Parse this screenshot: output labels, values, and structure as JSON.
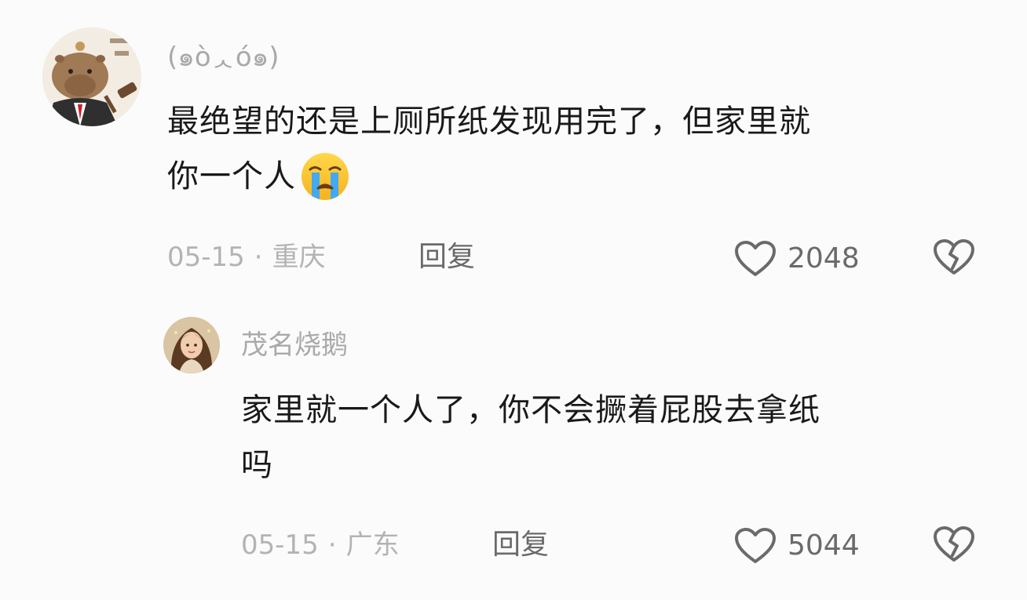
{
  "comments": [
    {
      "username": "(๑òᆺó๑)",
      "avatar_icon": "capybara-judge-avatar",
      "text_line1": "最绝望的还是上厕所纸发现用完了，但家里就",
      "text_line2": "你一个人",
      "emoji_icon": "crying-face-icon",
      "date": "05-15",
      "separator": "·",
      "location": "重庆",
      "reply_label": "回复",
      "like_count": "2048"
    },
    {
      "username": "茂名烧鹅",
      "avatar_icon": "girl-portrait-avatar",
      "text_line1": "家里就一个人了，你不会撅着屁股去拿纸",
      "text_line2": "吗",
      "date": "05-15",
      "separator": "·",
      "location": "广东",
      "reply_label": "回复",
      "like_count": "5044"
    }
  ],
  "colors": {
    "background": "#fbfbfb",
    "username": "#a9a9a9",
    "comment_text": "#191919",
    "meta_text": "#b3b3b3",
    "action_text": "#6a6a6a"
  }
}
